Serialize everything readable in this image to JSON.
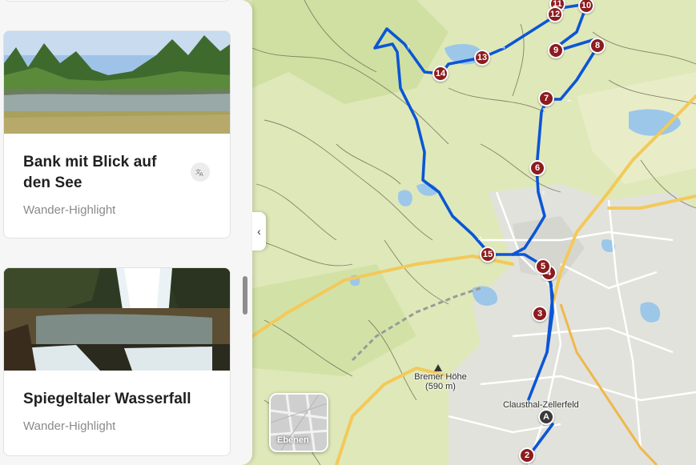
{
  "panel": {
    "cards": [
      {
        "title": "Bank mit Blick auf den See",
        "subtitle": "Wander-Highlight",
        "translate_icon": "translate-icon"
      },
      {
        "title": "Spiegeltaler Wasserfall",
        "subtitle": "Wander-Highlight"
      }
    ],
    "collapse_icon": "chevron-left-icon",
    "collapse_glyph": "‹"
  },
  "map": {
    "place_labels": {
      "peak_name": "Bremer Höhe",
      "peak_elevation": "(590 m)",
      "town": "Clausthal-Zellerfeld"
    },
    "waypoints": [
      "A",
      "2",
      "3",
      "4",
      "5",
      "6",
      "7",
      "8",
      "9",
      "10",
      "11",
      "12",
      "13",
      "14",
      "15"
    ],
    "layers_label": "Ebenen",
    "colors": {
      "route": "#0b56d6",
      "waypoint": "#8c1c1f",
      "start": "#3a3a3a",
      "road_major": "#f3c95a"
    }
  }
}
